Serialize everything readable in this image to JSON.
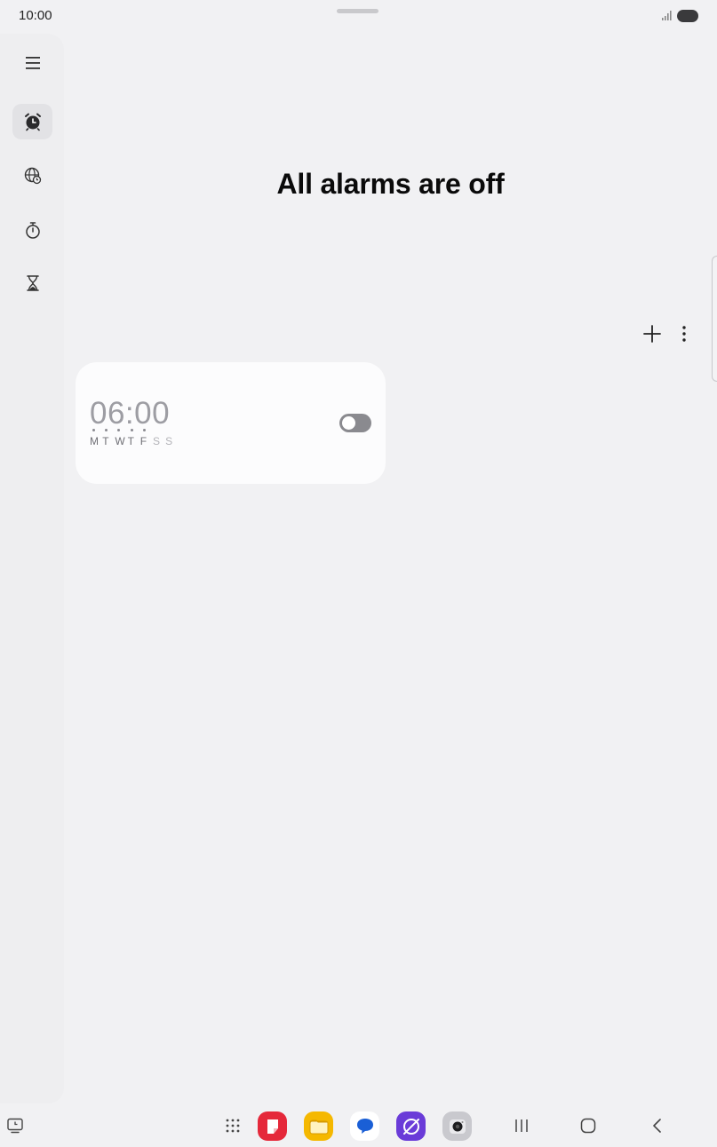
{
  "status_bar": {
    "time": "10:00"
  },
  "nav_rail": {
    "items": [
      {
        "name": "menu",
        "icon": "hamburger-menu-icon"
      },
      {
        "name": "alarm",
        "icon": "alarm-clock-icon",
        "active": true
      },
      {
        "name": "world-clock",
        "icon": "globe-clock-icon"
      },
      {
        "name": "stopwatch",
        "icon": "stopwatch-icon"
      },
      {
        "name": "timer",
        "icon": "hourglass-icon"
      }
    ]
  },
  "main": {
    "title": "All alarms are off",
    "toolbar": {
      "add_icon": "plus-icon",
      "more_icon": "more-vertical-icon"
    }
  },
  "alarms": [
    {
      "time": "06:00",
      "days": [
        {
          "label": "M",
          "on": true
        },
        {
          "label": "T",
          "on": true
        },
        {
          "label": "W",
          "on": true
        },
        {
          "label": "T",
          "on": true
        },
        {
          "label": "F",
          "on": true
        },
        {
          "label": "S",
          "on": false
        },
        {
          "label": "S",
          "on": false
        }
      ],
      "enabled": false
    }
  ],
  "taskbar": {
    "apps": [
      "apps-grid-icon",
      "notes-app-icon",
      "files-app-icon",
      "messages-app-icon",
      "internet-app-icon",
      "camera-app-icon"
    ],
    "system": [
      "recents-icon",
      "home-icon",
      "back-icon"
    ]
  },
  "colors": {
    "background": "#f1f1f3",
    "card": "#fcfcfd",
    "toggle_off": "#8a8a8f",
    "notes_red": "#e5283a",
    "files_yellow": "#f5b800",
    "messages_blue": "#1a5fd6",
    "internet_purple": "#6a3bd8"
  }
}
